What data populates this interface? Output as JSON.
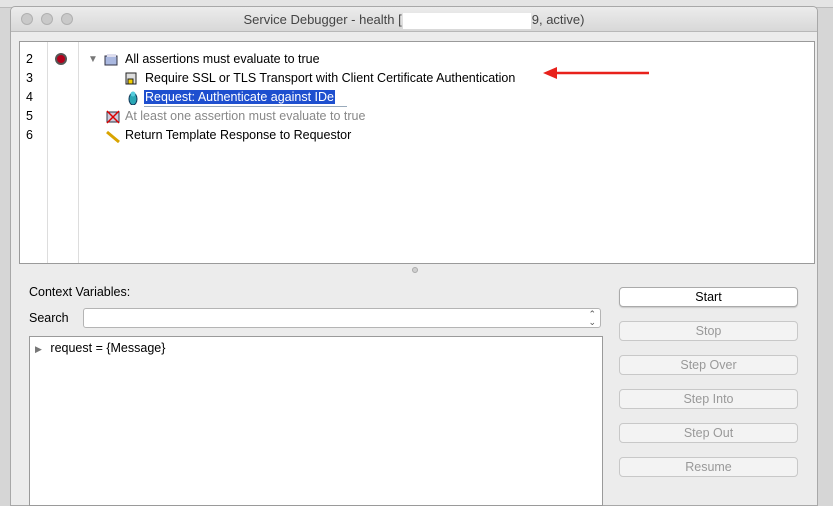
{
  "window": {
    "title_prefix": "Service Debugger - health [",
    "title_suffix": "9, active)"
  },
  "tree": {
    "rows": [
      {
        "line": "2",
        "label": "All assertions must evaluate to true",
        "icon": "folder-icon",
        "breakpoint": true
      },
      {
        "line": "3",
        "label": "Require SSL or TLS Transport with Client Certificate Authentication",
        "icon": "ssl-certificate-icon"
      },
      {
        "line": "4",
        "label": "Request: Authenticate against IDe",
        "icon": "identity-provider-icon",
        "selected": true
      },
      {
        "line": "5",
        "label": "At least one assertion must evaluate to true",
        "icon": "disabled-folder-icon",
        "disabled": true
      },
      {
        "line": "6",
        "label": "Return Template Response to Requestor",
        "icon": "pencil-icon"
      }
    ]
  },
  "context": {
    "title": "Context Variables:",
    "search_label": "Search",
    "search_value": "",
    "variables": [
      "request = {Message}"
    ]
  },
  "buttons": {
    "start": "Start",
    "stop": "Stop",
    "step_over": "Step Over",
    "step_into": "Step Into",
    "step_out": "Step Out",
    "resume": "Resume"
  },
  "colors": {
    "selection": "#1e4fcf",
    "breakpoint": "#b3001b",
    "annotation_arrow": "#e8211b"
  }
}
